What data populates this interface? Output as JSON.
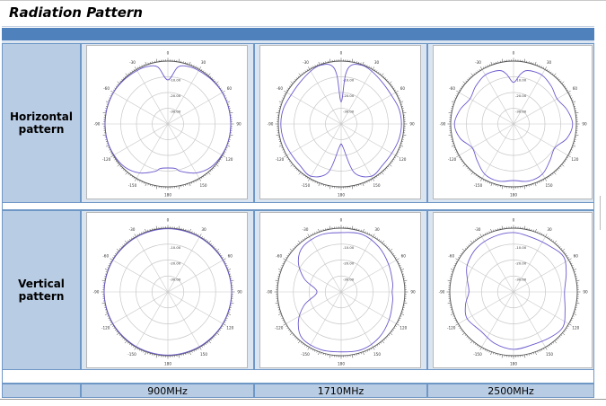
{
  "title": "Radiation Pattern",
  "rows": [
    {
      "label_line1": "Horizontal",
      "label_line2": "pattern"
    },
    {
      "label_line1": "Vertical",
      "label_line2": "pattern"
    }
  ],
  "frequencies": [
    "900MHz",
    "1710MHz",
    "2500MHz"
  ],
  "chart_data": [
    {
      "type": "polar",
      "row": "Horizontal pattern",
      "frequency": "900MHz",
      "angle_labels": [
        "0",
        "30",
        "60",
        "90",
        "120",
        "150",
        "180",
        "-150",
        "-120",
        "-90",
        "-60",
        "-30"
      ],
      "ring_labels": [
        "-10.00",
        "-20.00",
        "-30.00"
      ],
      "pattern": {
        "angles_deg": [
          0,
          10,
          20,
          30,
          45,
          60,
          75,
          90,
          105,
          120,
          135,
          150,
          165,
          170,
          180,
          190,
          195,
          210,
          225,
          240,
          255,
          270,
          285,
          300,
          315,
          330,
          340,
          350
        ],
        "radius": [
          0.7,
          0.92,
          0.97,
          0.98,
          0.99,
          1.0,
          1.0,
          1.0,
          1.0,
          0.99,
          0.97,
          0.9,
          0.78,
          0.72,
          0.7,
          0.72,
          0.78,
          0.9,
          0.97,
          0.99,
          1.0,
          1.0,
          1.0,
          1.0,
          0.99,
          0.98,
          0.97,
          0.92
        ]
      }
    },
    {
      "type": "polar",
      "row": "Horizontal pattern",
      "frequency": "1710MHz",
      "angle_labels": [
        "0",
        "30",
        "60",
        "90",
        "120",
        "150",
        "180",
        "-150",
        "-120",
        "-90",
        "-60",
        "-30"
      ],
      "ring_labels": [
        "-10.00",
        "-20.00",
        "-30.00"
      ],
      "pattern": {
        "angles_deg": [
          0,
          5,
          10,
          20,
          30,
          45,
          60,
          75,
          90,
          105,
          120,
          135,
          150,
          165,
          175,
          180,
          185,
          195,
          210,
          225,
          240,
          255,
          270,
          285,
          300,
          315,
          330,
          340,
          350,
          355
        ],
        "radius": [
          0.35,
          0.78,
          0.95,
          0.99,
          0.97,
          0.93,
          0.92,
          0.95,
          0.96,
          0.95,
          0.93,
          0.93,
          0.96,
          0.8,
          0.38,
          0.32,
          0.38,
          0.8,
          0.96,
          0.93,
          0.93,
          0.95,
          0.96,
          0.95,
          0.92,
          0.93,
          0.97,
          0.99,
          0.95,
          0.78
        ]
      }
    },
    {
      "type": "polar",
      "row": "Horizontal pattern",
      "frequency": "2500MHz",
      "angle_labels": [
        "0",
        "30",
        "60",
        "90",
        "120",
        "150",
        "180",
        "-150",
        "-120",
        "-90",
        "-60",
        "-30"
      ],
      "ring_labels": [
        "-10.00",
        "-20.00",
        "-30.00"
      ],
      "pattern": {
        "angles_deg": [
          0,
          8,
          15,
          30,
          45,
          60,
          75,
          90,
          105,
          120,
          135,
          150,
          165,
          180,
          195,
          210,
          225,
          240,
          255,
          270,
          285,
          300,
          315,
          330,
          345,
          352
        ],
        "radius": [
          0.66,
          0.8,
          0.88,
          0.9,
          0.85,
          0.8,
          0.88,
          0.94,
          0.88,
          0.76,
          0.82,
          0.92,
          0.94,
          0.9,
          0.94,
          0.92,
          0.82,
          0.76,
          0.88,
          0.94,
          0.88,
          0.8,
          0.85,
          0.9,
          0.88,
          0.8
        ]
      }
    },
    {
      "type": "polar",
      "row": "Vertical pattern",
      "frequency": "900MHz",
      "angle_labels": [
        "0",
        "30",
        "60",
        "90",
        "120",
        "150",
        "180",
        "-150",
        "-120",
        "-90",
        "-60",
        "-30"
      ],
      "ring_labels": [
        "-10.00",
        "-20.00",
        "-30.00"
      ],
      "pattern": {
        "angles_deg": [
          0,
          30,
          60,
          90,
          120,
          150,
          180,
          210,
          240,
          270,
          300,
          330
        ],
        "radius": [
          0.99,
          0.99,
          0.995,
          1.0,
          0.995,
          0.99,
          0.99,
          0.99,
          0.995,
          1.0,
          0.995,
          0.99
        ]
      }
    },
    {
      "type": "polar",
      "row": "Vertical pattern",
      "frequency": "1710MHz",
      "angle_labels": [
        "0",
        "30",
        "60",
        "90",
        "120",
        "150",
        "180",
        "-150",
        "-120",
        "-90",
        "-60",
        "-30"
      ],
      "ring_labels": [
        "-10.00",
        "-20.00",
        "-30.00"
      ],
      "pattern": {
        "angles_deg": [
          0,
          20,
          40,
          60,
          80,
          90,
          100,
          120,
          140,
          160,
          180,
          200,
          220,
          235,
          250,
          262,
          270,
          278,
          290,
          305,
          320,
          340
        ],
        "radius": [
          0.93,
          0.96,
          0.92,
          0.86,
          0.82,
          0.8,
          0.82,
          0.87,
          0.93,
          0.96,
          0.94,
          0.96,
          0.95,
          0.82,
          0.62,
          0.42,
          0.38,
          0.42,
          0.62,
          0.82,
          0.93,
          0.95
        ]
      }
    },
    {
      "type": "polar",
      "row": "Vertical pattern",
      "frequency": "2500MHz",
      "angle_labels": [
        "0",
        "30",
        "60",
        "90",
        "120",
        "150",
        "180",
        "-150",
        "-120",
        "-90",
        "-60",
        "-30"
      ],
      "ring_labels": [
        "-10.00",
        "-20.00",
        "-30.00"
      ],
      "pattern": {
        "angles_deg": [
          0,
          20,
          40,
          55,
          70,
          90,
          110,
          125,
          140,
          160,
          180,
          200,
          220,
          240,
          255,
          270,
          285,
          300,
          320,
          340
        ],
        "radius": [
          0.93,
          0.9,
          0.92,
          0.96,
          0.88,
          0.8,
          0.86,
          0.95,
          0.92,
          0.88,
          0.9,
          0.86,
          0.8,
          0.84,
          0.78,
          0.7,
          0.75,
          0.84,
          0.9,
          0.92
        ]
      }
    }
  ]
}
